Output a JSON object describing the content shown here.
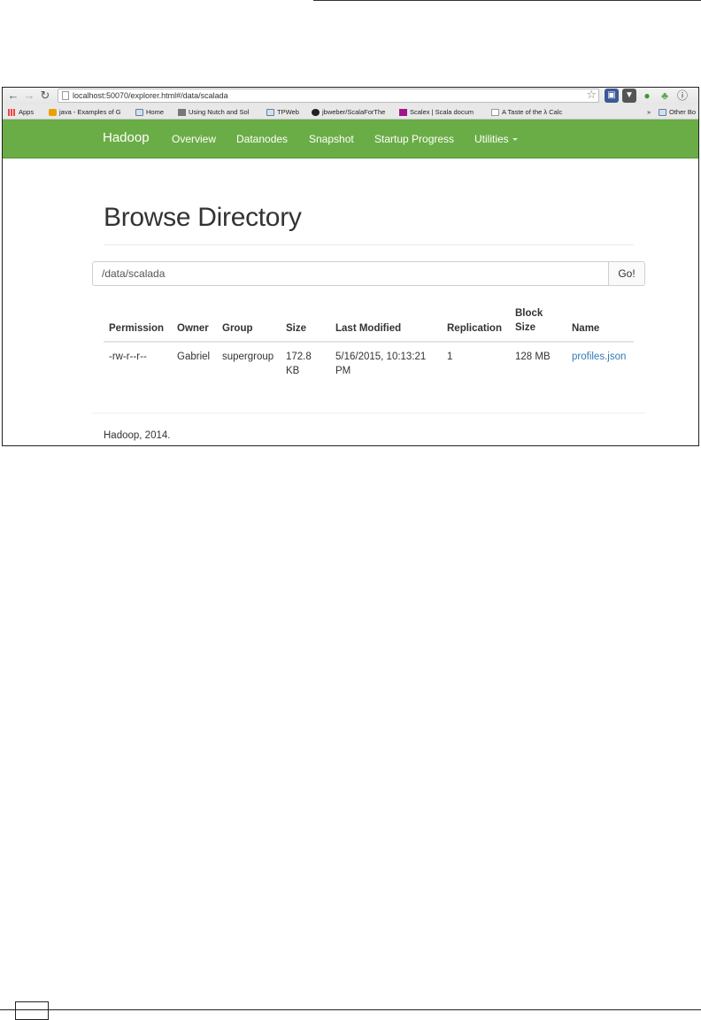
{
  "browser": {
    "url": "localhost:50070/explorer.html#/data/scalada",
    "bookmarks": [
      {
        "label": "Apps",
        "icon": "apps-icon"
      },
      {
        "label": "java - Examples of G",
        "icon": "java-icon"
      },
      {
        "label": "Home",
        "icon": "folder-icon"
      },
      {
        "label": "Using Nutch and Sol",
        "icon": "page-icon"
      },
      {
        "label": "TPWeb",
        "icon": "folder-icon"
      },
      {
        "label": "jbweber/ScalaForThe",
        "icon": "github-icon"
      },
      {
        "label": "Scalex | Scala docum",
        "icon": "scalex-icon"
      },
      {
        "label": "A Taste of the λ Calc",
        "icon": "document-icon"
      }
    ],
    "overflow_label": "»",
    "other_bookmarks": "Other Bo"
  },
  "navbar": {
    "brand": "Hadoop",
    "items": [
      "Overview",
      "Datanodes",
      "Snapshot",
      "Startup Progress",
      "Utilities"
    ],
    "color": "#6aad46"
  },
  "main": {
    "title": "Browse Directory",
    "path_value": "/data/scalada",
    "go_label": "Go!",
    "table": {
      "headers": [
        "Permission",
        "Owner",
        "Group",
        "Size",
        "Last Modified",
        "Replication",
        "Block Size",
        "Name"
      ],
      "rows": [
        {
          "permission": "-rw-r--r--",
          "owner": "Gabriel",
          "group": "supergroup",
          "size": "172.8 KB",
          "last_modified": "5/16/2015, 10:13:21 PM",
          "replication": "1",
          "block_size": "128 MB",
          "name": "profiles.json"
        }
      ]
    }
  },
  "footer": {
    "text": "Hadoop, 2014."
  }
}
